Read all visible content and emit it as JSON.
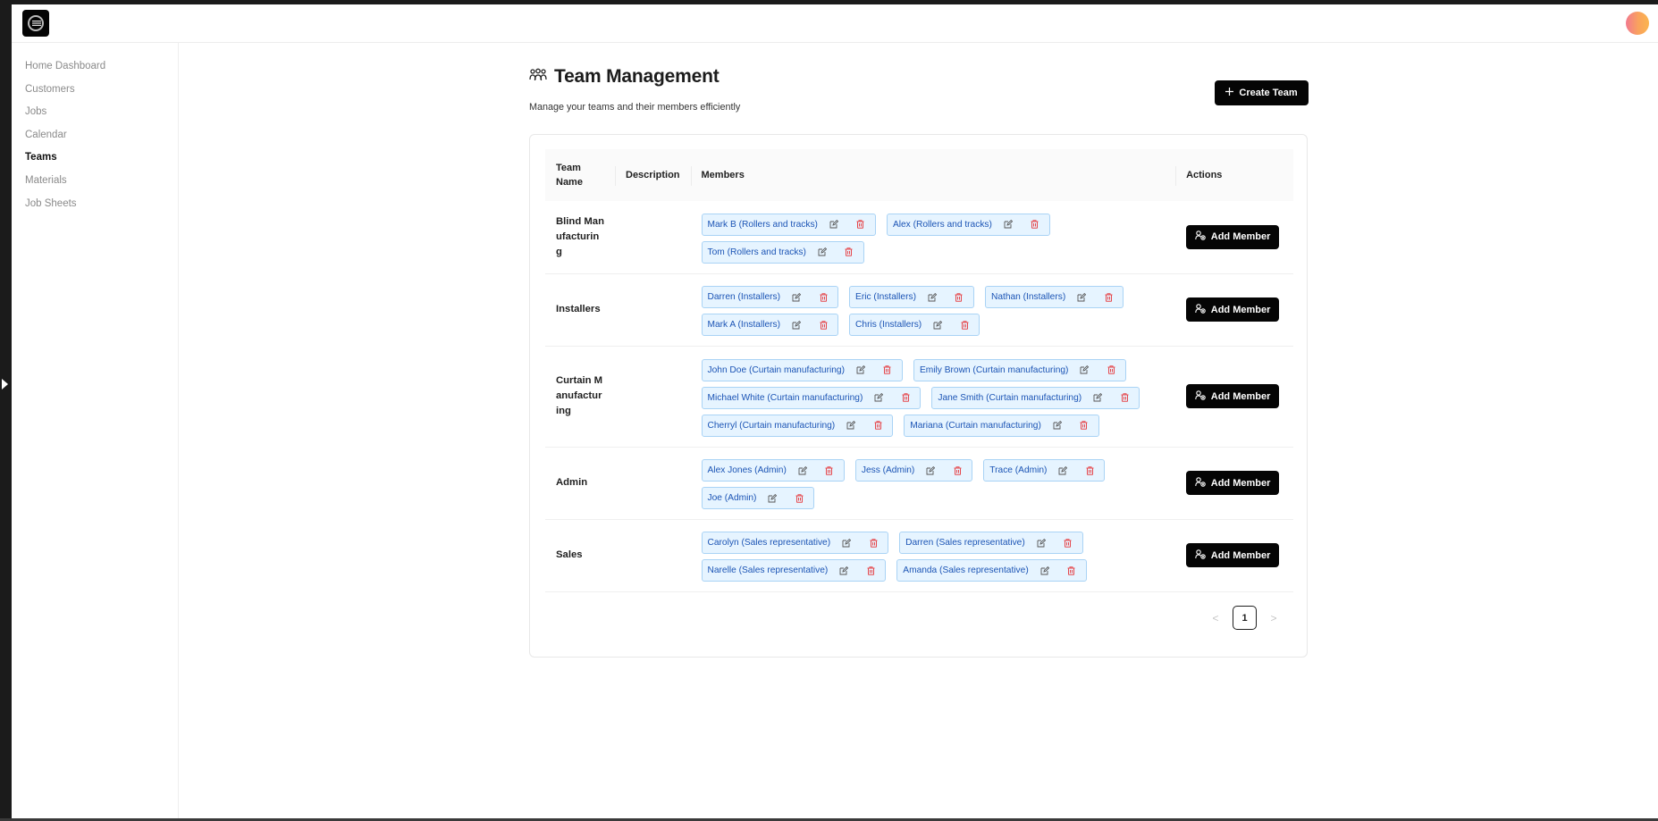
{
  "app": {
    "logo_icon": "brand-logo-icon",
    "avatar_icon": "user-avatar"
  },
  "sidebar": {
    "items": [
      {
        "label": "Home Dashboard",
        "active": false
      },
      {
        "label": "Customers",
        "active": false
      },
      {
        "label": "Jobs",
        "active": false
      },
      {
        "label": "Calendar",
        "active": false
      },
      {
        "label": "Teams",
        "active": true
      },
      {
        "label": "Materials",
        "active": false
      },
      {
        "label": "Job Sheets",
        "active": false
      }
    ]
  },
  "header": {
    "title": "Team Management",
    "title_icon": "team-icon",
    "subtitle": "Manage your teams and their members efficiently",
    "create_button": "Create Team",
    "create_icon": "plus-icon"
  },
  "table": {
    "columns": [
      "Team Name",
      "Description",
      "Members",
      "Actions"
    ],
    "add_member_label": "Add Member",
    "rows": [
      {
        "team": "Blind Manufacturing",
        "description": "",
        "members": [
          "Mark B (Rollers and tracks)",
          "Alex (Rollers and tracks)",
          "Tom (Rollers and tracks)"
        ]
      },
      {
        "team": "Installers",
        "description": "",
        "members": [
          "Darren (Installers)",
          "Eric (Installers)",
          "Nathan (Installers)",
          "Mark A (Installers)",
          "Chris (Installers)"
        ]
      },
      {
        "team": "Curtain Manufacturing",
        "description": "",
        "members": [
          "John Doe (Curtain manufacturing)",
          "Emily Brown (Curtain manufacturing)",
          "Michael White (Curtain manufacturing)",
          "Jane Smith (Curtain manufacturing)",
          "Cherryl (Curtain manufacturing)",
          "Mariana (Curtain manufacturing)"
        ]
      },
      {
        "team": "Admin",
        "description": "",
        "members": [
          "Alex Jones (Admin)",
          "Jess (Admin)",
          "Trace (Admin)",
          "Joe (Admin)"
        ]
      },
      {
        "team": "Sales",
        "description": "",
        "members": [
          "Carolyn (Sales representative)",
          "Darren (Sales representative)",
          "Narelle (Sales representative)",
          "Amanda (Sales representative)"
        ]
      }
    ]
  },
  "pagination": {
    "prev": "<",
    "current": "1",
    "next": ">"
  },
  "colors": {
    "primary": "#050505",
    "chip_bg": "#e6f4ff",
    "chip_border": "#a9d3f5",
    "chip_text": "#1b54b5",
    "delete": "#e5484d"
  }
}
